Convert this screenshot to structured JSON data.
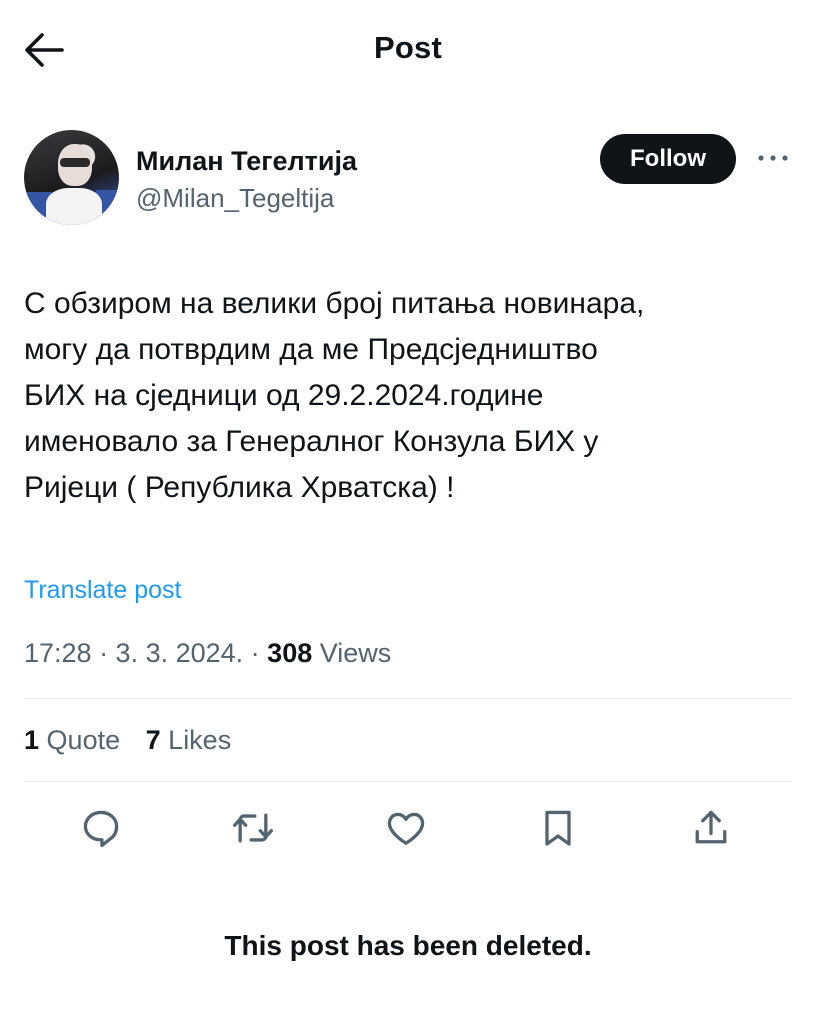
{
  "header": {
    "title": "Post",
    "back_icon": "arrow-left-icon"
  },
  "author": {
    "name": "Милан Тегелтија",
    "handle": "@Milan_Tegeltija",
    "follow_label": "Follow",
    "more_icon": "more-horizontal-icon"
  },
  "post": {
    "text": "С обзиром на велики број питања новинара,\nмогу да потврдим да ме Предсједништво\nБИХ на сједници од 29.2.2024.године\nименовало за Генералног Конзула БИХ у\nРијеци ( Република Хрватска) !",
    "translate_label": "Translate post",
    "timestamp": "17:28 · 3. 3. 2024. · ",
    "views_count": "308",
    "views_label": " Views"
  },
  "stats": {
    "quotes_count": "1",
    "quotes_label": "Quote",
    "likes_count": "7",
    "likes_label": "Likes"
  },
  "actions": {
    "icons": [
      "reply-icon",
      "repost-icon",
      "like-icon",
      "bookmark-icon",
      "share-icon"
    ]
  },
  "notice": {
    "deleted_text": "This post has been deleted."
  },
  "colors": {
    "text": "#0f1419",
    "secondary": "#536471",
    "link": "#1d9bf0",
    "follow_bg": "#0f1419",
    "divider": "#e1e6ea"
  }
}
